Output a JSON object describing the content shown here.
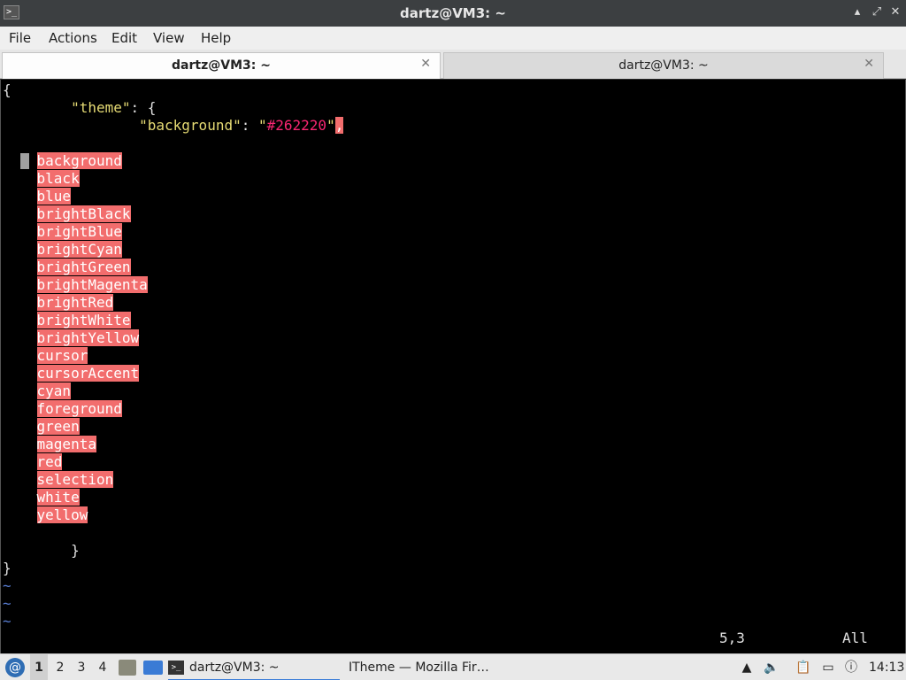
{
  "window": {
    "title": "dartz@VM3: ~",
    "icon": "terminal-icon",
    "controls": {
      "minimize": "▴",
      "restore": "⤢",
      "close": "✕"
    }
  },
  "menu": {
    "file": "File",
    "actions": "Actions",
    "edit": "Edit",
    "view": "View",
    "help": "Help"
  },
  "tabs": [
    {
      "label": "dartz@VM3: ~",
      "active": true,
      "close": "✕"
    },
    {
      "label": "dartz@VM3: ~",
      "active": false,
      "close": "✕"
    }
  ],
  "editor": {
    "open_brace": "{",
    "theme_key": "\"theme\"",
    "theme_sep": ": {",
    "bg_key": "\"background\"",
    "bg_sep": ": ",
    "bg_value": "\"#262220\"",
    "bg_comma": ",",
    "completions": [
      "background",
      "black",
      "blue",
      "brightBlack",
      "brightBlue",
      "brightCyan",
      "brightGreen",
      "brightMagenta",
      "brightRed",
      "brightWhite",
      "brightYellow",
      "cursor",
      "cursorAccent",
      "cyan",
      "foreground",
      "green",
      "magenta",
      "red",
      "selection",
      "white",
      "yellow"
    ],
    "inner_close": "}",
    "outer_close": "}",
    "tilde": "~",
    "status_position": "5,3",
    "status_scroll": "All"
  },
  "taskbar": {
    "menu_icon": "debian-swirl-icon",
    "workspaces": [
      "1",
      "2",
      "3",
      "4"
    ],
    "tasks": [
      {
        "label": "dartz@VM3: ~",
        "icon": "terminal-icon"
      },
      {
        "label": "ITheme — Mozilla Fir…",
        "icon": "firefox-icon"
      }
    ],
    "clock": "14:13"
  },
  "colors": {
    "terminal_bg": "#000000",
    "string": "#e6db74",
    "hex_value": "#f92672",
    "completion_highlight": "#f26d6d",
    "tilde": "#5a7fd6"
  }
}
